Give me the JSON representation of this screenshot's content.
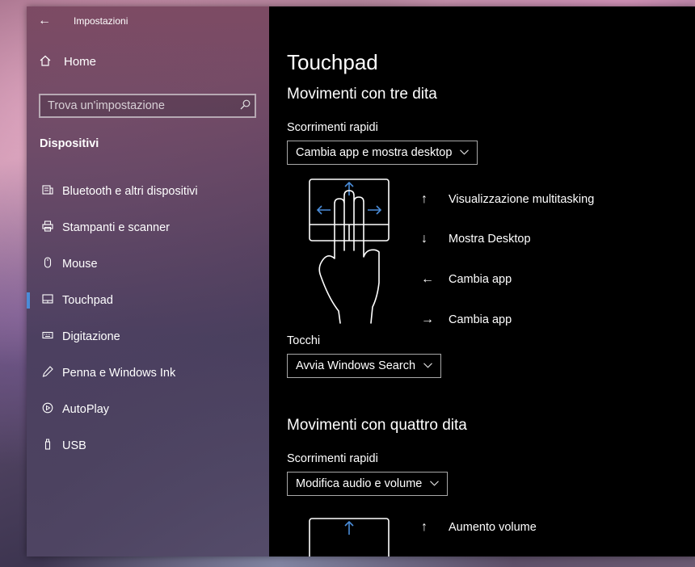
{
  "window": {
    "title": "Impostazioni"
  },
  "sidebar": {
    "home_label": "Home",
    "search_placeholder": "Trova un'impostazione",
    "section_title": "Dispositivi",
    "items": [
      {
        "label": "Bluetooth e altri dispositivi",
        "icon": "bluetooth-devices-icon"
      },
      {
        "label": "Stampanti e scanner",
        "icon": "printer-icon"
      },
      {
        "label": "Mouse",
        "icon": "mouse-icon"
      },
      {
        "label": "Touchpad",
        "icon": "touchpad-icon"
      },
      {
        "label": "Digitazione",
        "icon": "keyboard-icon"
      },
      {
        "label": "Penna e Windows Ink",
        "icon": "pen-icon"
      },
      {
        "label": "AutoPlay",
        "icon": "autoplay-icon"
      },
      {
        "label": "USB",
        "icon": "usb-icon"
      }
    ],
    "selected_index": 3
  },
  "main": {
    "title": "Touchpad",
    "three_finger": {
      "heading": "Movimenti con tre dita",
      "swipes_label": "Scorrimenti rapidi",
      "swipes_value": "Cambia app e mostra desktop",
      "gestures": [
        {
          "arrow": "↑",
          "text": "Visualizzazione multitasking"
        },
        {
          "arrow": "↓",
          "text": "Mostra Desktop"
        },
        {
          "arrow": "←",
          "text": "Cambia app"
        },
        {
          "arrow": "→",
          "text": "Cambia app"
        }
      ],
      "taps_label": "Tocchi",
      "taps_value": "Avvia Windows Search"
    },
    "four_finger": {
      "heading": "Movimenti con quattro dita",
      "swipes_label": "Scorrimenti rapidi",
      "swipes_value": "Modifica audio e volume",
      "gestures": [
        {
          "arrow": "↑",
          "text": "Aumento volume"
        }
      ]
    }
  },
  "colors": {
    "accent": "#4a8cd8",
    "main_bg": "#000000"
  }
}
